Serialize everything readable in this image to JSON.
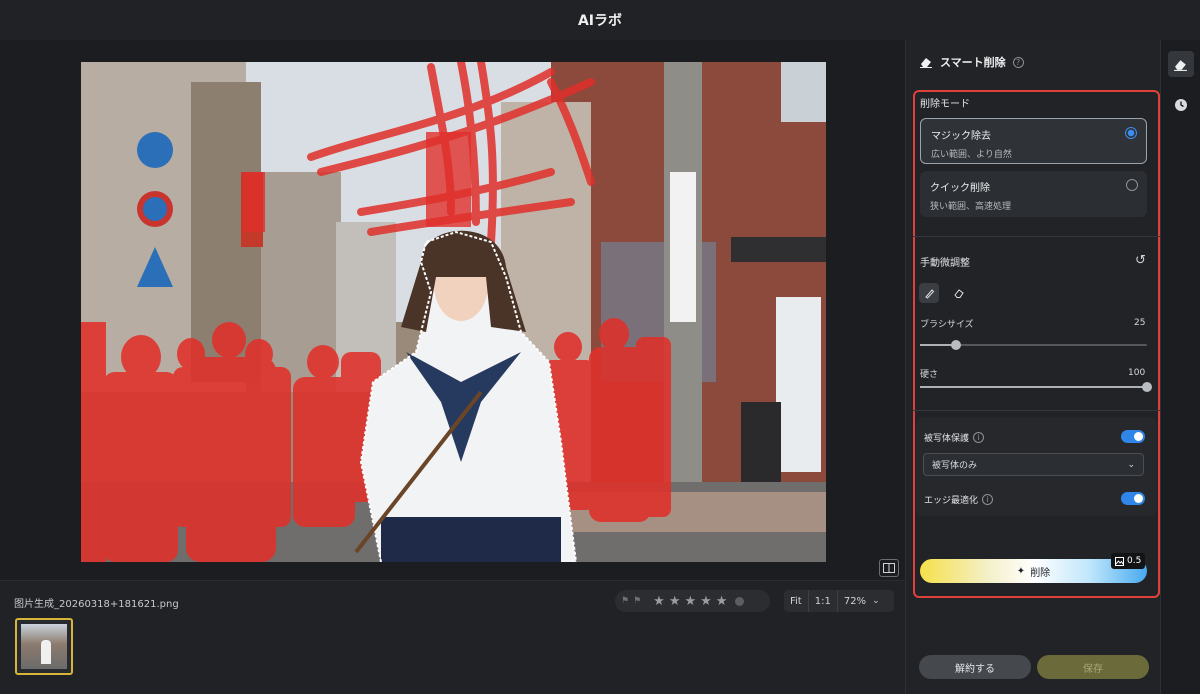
{
  "app": {
    "title": "AIラボ"
  },
  "canvas": {
    "compare_icon": "split-view-icon"
  },
  "bottom": {
    "filename": "图片生成_20260318+181621.png",
    "rating": {
      "stars": 5,
      "star_glyph": "★",
      "flag_glyph": "⚑"
    },
    "zoom": {
      "fit_label": "Fit",
      "one_to_one_label": "1:1",
      "zoom_value": "72%"
    }
  },
  "panel": {
    "title": "スマート削除",
    "mode_section": {
      "title": "削除モード",
      "modes": [
        {
          "title": "マジック除去",
          "subtitle": "広い範囲、より自然",
          "selected": true
        },
        {
          "title": "クイック削除",
          "subtitle": "狭い範囲、高速処理",
          "selected": false
        }
      ]
    },
    "manual": {
      "title": "手動微調整",
      "brush_size_label": "ブラシサイズ",
      "brush_size_value": "25",
      "brush_size_fraction": 0.16,
      "hardness_label": "硬さ",
      "hardness_value": "100",
      "hardness_fraction": 1.0
    },
    "options": {
      "subject_protect_label": "被写体保護",
      "subject_protect_on": true,
      "subject_select_value": "被写体のみ",
      "edge_opt_label": "エッジ最適化",
      "edge_opt_on": true
    },
    "delete_label": "削除",
    "credit_value": "0.5",
    "unlock_label": "解約する",
    "save_label": "保存"
  },
  "colors": {
    "accent": "#2f86e8",
    "highlight_box": "#e0413c",
    "save_button": "#6b6a3a",
    "mask": "#e0302a"
  }
}
